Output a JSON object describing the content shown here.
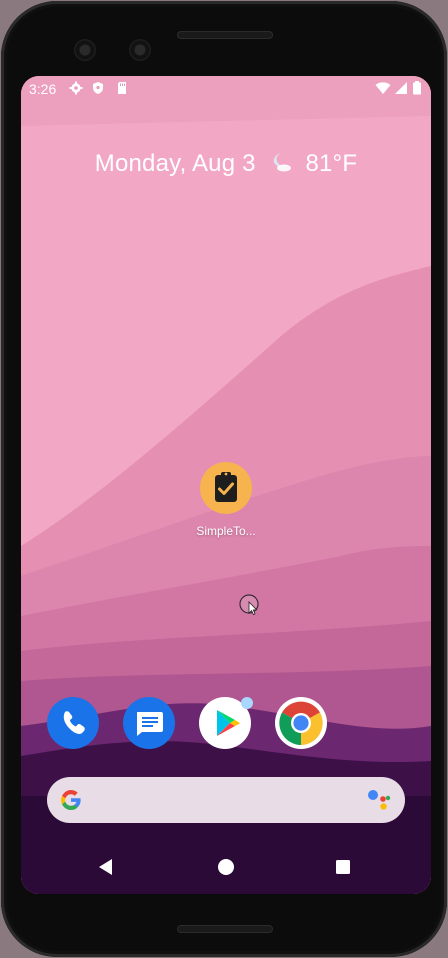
{
  "status_bar": {
    "time": "3:26",
    "left_icons": [
      "settings-icon",
      "shield-icon",
      "sd-card-icon"
    ],
    "right_icons": [
      "wifi-icon",
      "signal-icon",
      "battery-icon"
    ]
  },
  "glance": {
    "date": "Monday, Aug 3",
    "weather_icon": "moon-cloud-icon",
    "temperature": "81°F"
  },
  "home_apps": [
    {
      "label": "SimpleTo...",
      "icon": "clipboard-check-icon",
      "color": "#f7b34e"
    }
  ],
  "dock": [
    {
      "name": "phone",
      "icon": "phone-icon",
      "color": "#1a73e8"
    },
    {
      "name": "messages",
      "icon": "messages-icon",
      "color": "#1a73e8"
    },
    {
      "name": "play-store",
      "icon": "play-store-icon",
      "color": "#ffffff",
      "has_notification_dot": true
    },
    {
      "name": "chrome",
      "icon": "chrome-icon",
      "color": "#ffffff"
    }
  ],
  "search": {
    "left_icon": "google-g-icon",
    "right_icon": "google-assistant-icon"
  },
  "nav": [
    "back-icon",
    "home-icon",
    "recents-icon"
  ],
  "colors": {
    "sky": "#f2a8c4",
    "hills_dark": "#3a0f4a",
    "dock_bg": "#2b0a38",
    "search_bg": "#e8dce6"
  }
}
